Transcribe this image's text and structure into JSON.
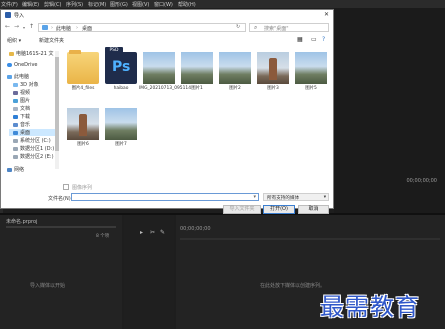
{
  "app": {
    "menu": [
      "文件(F)",
      "编辑(E)",
      "剪辑(C)",
      "序列(S)",
      "标记(M)",
      "图形(G)",
      "视图(V)",
      "窗口(W)",
      "帮助(H)"
    ],
    "timecode_right": "00;00;00;00",
    "bottom_left_tab": "未命名.prproj",
    "bottom_left_hint": "导入媒体以开始",
    "timeline_timecode": "00;00;00;00",
    "timeline_hint": "在此处放下媒体以创建序列。",
    "panel_a_count": "8 个项"
  },
  "dialog": {
    "title": "导入",
    "nav": {
      "back_icon": "arrow-left-icon",
      "forward_icon": "arrow-right-icon",
      "up_icon": "arrow-up-icon",
      "breadcrumbs": [
        "此电脑",
        "桌面"
      ],
      "search_placeholder": "搜索\"桌面\""
    },
    "toolbar": {
      "organize": "组织 ▾",
      "new_folder": "新建文件夹"
    },
    "sidebar": [
      {
        "label": "电脑161S-21 文",
        "icon": "folder"
      },
      {
        "label": "OneDrive",
        "icon": "cloud"
      },
      {
        "label": "此电脑",
        "icon": "pc"
      },
      {
        "label": "3D 对象",
        "icon": "cube"
      },
      {
        "label": "视频",
        "icon": "video"
      },
      {
        "label": "图片",
        "icon": "picture"
      },
      {
        "label": "文档",
        "icon": "document"
      },
      {
        "label": "下载",
        "icon": "download"
      },
      {
        "label": "音乐",
        "icon": "music"
      },
      {
        "label": "桌面",
        "icon": "desktop",
        "selected": true
      },
      {
        "label": "系统分区 (C:)",
        "icon": "drive"
      },
      {
        "label": "数据分区1 (D:)",
        "icon": "drive"
      },
      {
        "label": "数据分区2 (E:)",
        "icon": "drive"
      },
      {
        "label": "网络",
        "icon": "network"
      }
    ],
    "files": [
      {
        "name": "图片4_files",
        "kind": "folder"
      },
      {
        "name": "haibao",
        "kind": "psd"
      },
      {
        "name": "IMG_20210713_095114",
        "kind": "photo-sky"
      },
      {
        "name": "图片1",
        "kind": "photo-sky"
      },
      {
        "name": "图片2",
        "kind": "photo-sky"
      },
      {
        "name": "图片3",
        "kind": "photo-tower"
      },
      {
        "name": "图片5",
        "kind": "photo-sky"
      },
      {
        "name": "图片6",
        "kind": "photo-tower"
      },
      {
        "name": "图片7",
        "kind": "photo-sky"
      }
    ],
    "image_sequence_label": "图像序列",
    "filename_label": "文件名(N):",
    "filename_value": "",
    "filetype_value": "所有支持的媒体",
    "buttons": {
      "import_folder": "导入文件夹",
      "open": "打开(O)",
      "cancel": "取消"
    }
  },
  "watermark": "最需教育"
}
